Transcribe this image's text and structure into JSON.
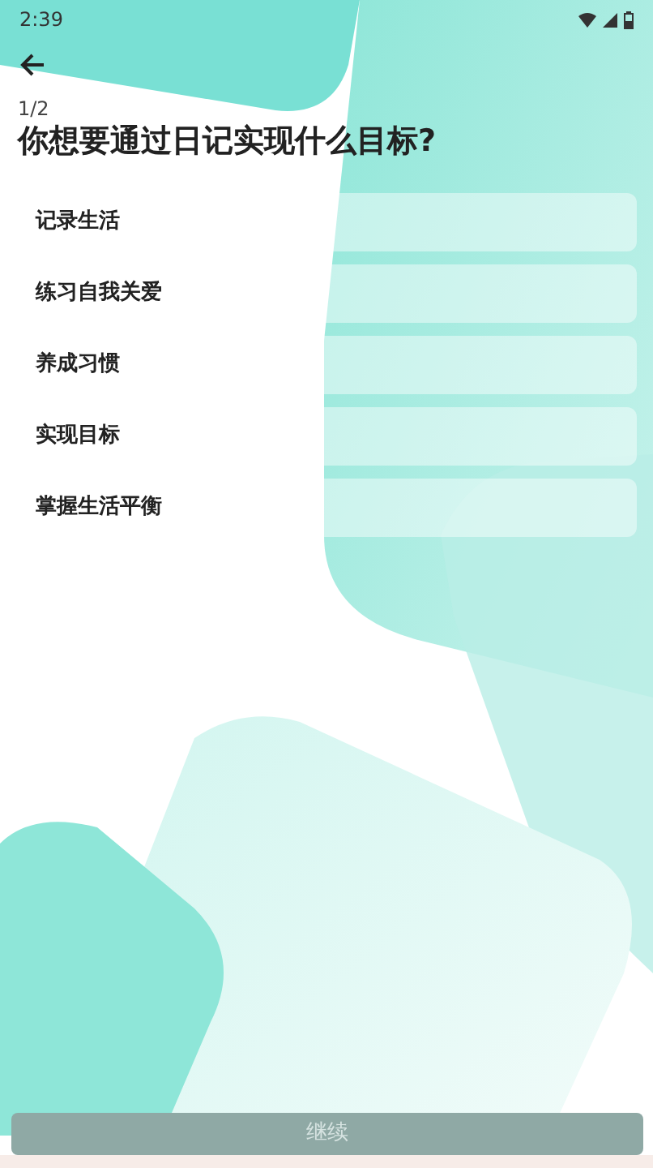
{
  "status_bar": {
    "time": "2:39"
  },
  "progress": "1/2",
  "title": "你想要通过日记实现什么目标?",
  "options": [
    {
      "label": "记录生活",
      "selected": false
    },
    {
      "label": "练习自我关爱",
      "selected": false
    },
    {
      "label": "养成习惯",
      "selected": false
    },
    {
      "label": "实现目标",
      "selected": false
    },
    {
      "label": "掌握生活平衡",
      "selected": false
    }
  ],
  "continue_button": {
    "label": "继续",
    "disabled": true
  }
}
